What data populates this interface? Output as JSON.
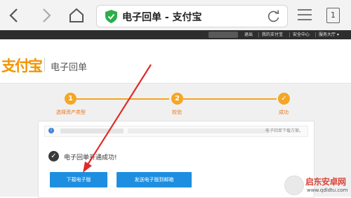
{
  "browser": {
    "page_title": "电子回单 - 支付宝",
    "tab_count": "1"
  },
  "topnav": {
    "items": [
      "退出",
      "我的支付宝",
      "安全中心",
      "服务大厅 ▾"
    ]
  },
  "header": {
    "logo": "支付宝",
    "heading": "电子回单"
  },
  "steps": [
    {
      "number": "1",
      "label": "选择资产类型"
    },
    {
      "number": "2",
      "label": "校验"
    },
    {
      "number": "✓",
      "label": "成功"
    }
  ],
  "notice": {
    "text": "电子回单下载方案。"
  },
  "result": {
    "message": "电子回单开通成功!"
  },
  "buttons": {
    "download": "下载电子版",
    "send_email": "发送电子版到邮箱"
  },
  "watermark": {
    "name": "启东安卓网",
    "url": "www.qdldtu.com"
  },
  "colors": {
    "accent": "#f5a623",
    "button_blue": "#1e8fe0",
    "arrow_red": "#e02a2a"
  }
}
